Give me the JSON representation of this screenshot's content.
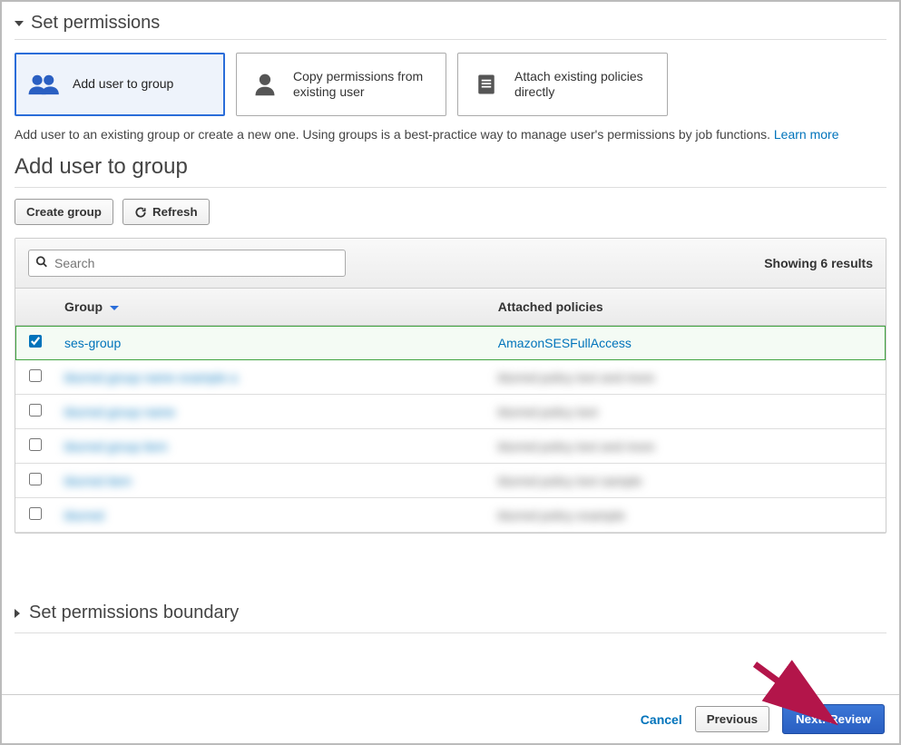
{
  "section_title": "Set permissions",
  "tabs": [
    {
      "label": "Add user to group"
    },
    {
      "label": "Copy permissions from existing user"
    },
    {
      "label": "Attach existing policies directly"
    }
  ],
  "help_text": "Add user to an existing group or create a new one. Using groups is a best-practice way to manage user's permissions by job functions. ",
  "learn_more": "Learn more",
  "subheading": "Add user to group",
  "buttons": {
    "create_group": "Create group",
    "refresh": "Refresh"
  },
  "search": {
    "placeholder": "Search"
  },
  "results_text": "Showing 6 results",
  "columns": {
    "group": "Group",
    "policies": "Attached policies"
  },
  "rows": [
    {
      "group": "ses-group",
      "policies": "AmazonSESFullAccess",
      "checked": true
    },
    {
      "group": "blurred group name example a",
      "policies": "blurred policy text and more",
      "checked": false,
      "blurred": true
    },
    {
      "group": "blurred group name",
      "policies": "blurred policy text",
      "checked": false,
      "blurred": true
    },
    {
      "group": "blurred group item",
      "policies": "blurred policy text and more",
      "checked": false,
      "blurred": true
    },
    {
      "group": "blurred item",
      "policies": "blurred policy text sample",
      "checked": false,
      "blurred": true
    },
    {
      "group": "blurred",
      "policies": "blurred policy example",
      "checked": false,
      "blurred": true
    }
  ],
  "boundary_title": "Set permissions boundary",
  "footer": {
    "cancel": "Cancel",
    "previous": "Previous",
    "next": "Next: Review"
  }
}
